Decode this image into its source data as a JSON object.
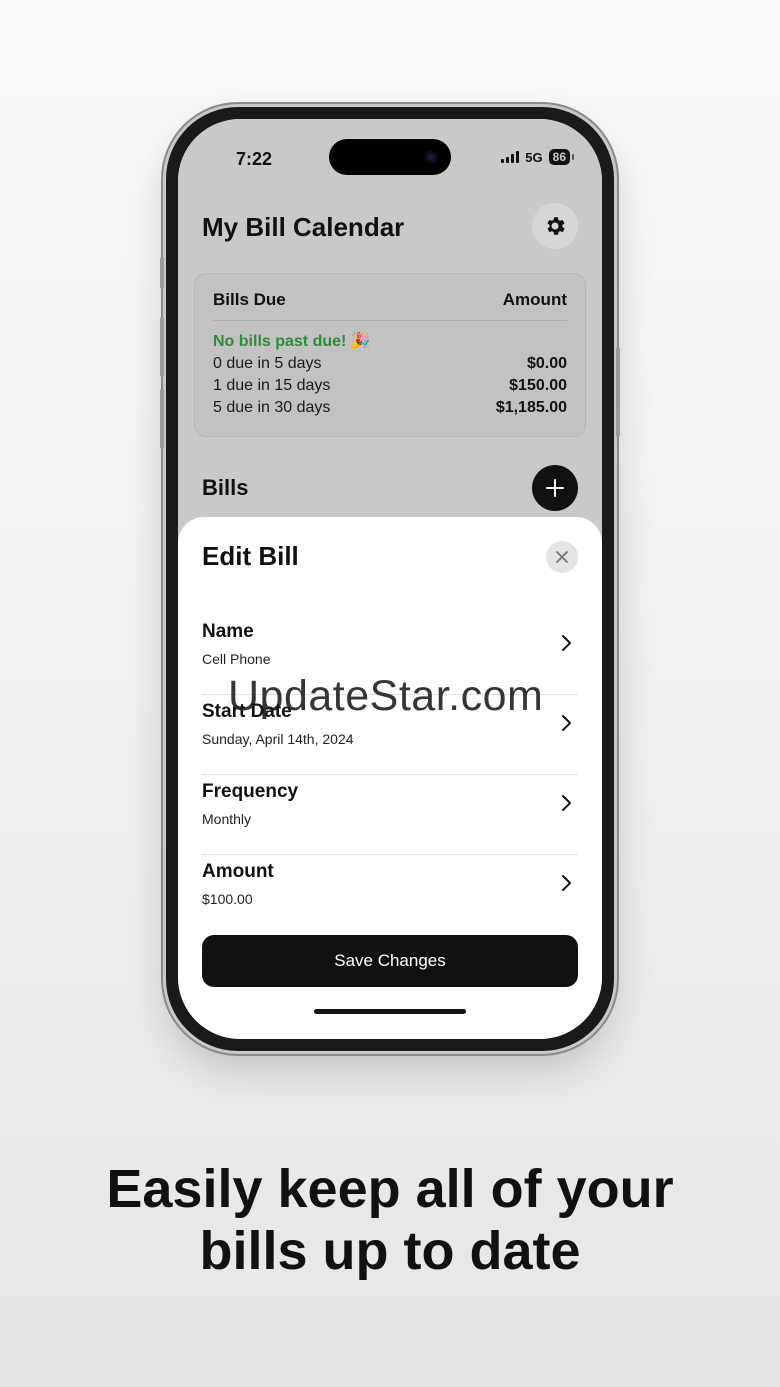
{
  "status_bar": {
    "time": "7:22",
    "network": "5G",
    "battery": "86"
  },
  "app": {
    "title": "My Bill Calendar",
    "settings_icon": "gear-icon",
    "summary": {
      "header_left": "Bills Due",
      "header_right": "Amount",
      "past_due_text": "No bills past due! 🎉",
      "rows": [
        {
          "label": "0 due in 5 days",
          "amount": "$0.00"
        },
        {
          "label": "1 due in 15 days",
          "amount": "$150.00"
        },
        {
          "label": "5 due in 30 days",
          "amount": "$1,185.00"
        }
      ]
    },
    "bills_title": "Bills",
    "add_icon": "plus-icon"
  },
  "sheet": {
    "title": "Edit Bill",
    "close_icon": "close-icon",
    "fields": [
      {
        "label": "Name",
        "value": "Cell Phone"
      },
      {
        "label": "Start Date",
        "value": "Sunday, April 14th, 2024"
      },
      {
        "label": "Frequency",
        "value": "Monthly"
      },
      {
        "label": "Amount",
        "value": "$100.00"
      }
    ],
    "save_label": "Save Changes"
  },
  "watermark": "UpdateStar.com",
  "tagline": {
    "line1": "Easily keep all of your",
    "line2": "bills up to date"
  },
  "colors": {
    "accent_green": "#2f8c3a",
    "button_dark": "#111111"
  }
}
